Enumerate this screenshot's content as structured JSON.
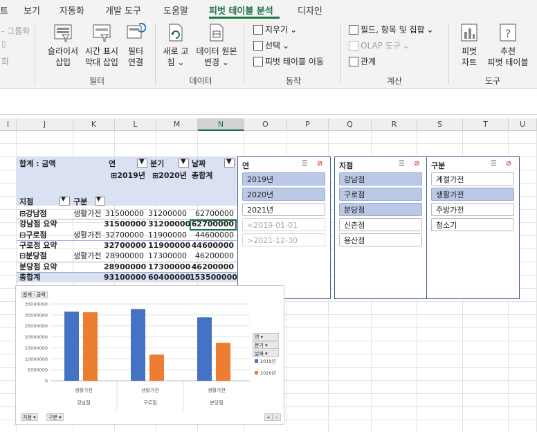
{
  "tabs": {
    "items": [
      "트",
      "보기",
      "자동화",
      "개발 도구",
      "도움말",
      "피벗 테이블 분석",
      "디자인"
    ],
    "active_index": 5
  },
  "ribbon": {
    "group_cut": {
      "label_1": "- 그룹화",
      "label_2": "화"
    },
    "filter": {
      "slicer": [
        "슬라이서",
        "삽입"
      ],
      "timeline": [
        "시간 표시",
        "막대 삽입"
      ],
      "connect": [
        "필터",
        "연결"
      ],
      "group_label": "필터"
    },
    "data": {
      "refresh": [
        "새로 고",
        "침"
      ],
      "change_source": [
        "데이터 원본",
        "변경"
      ],
      "group_label": "데이터"
    },
    "actions": {
      "clear": "지우기",
      "select": "선택",
      "move": "피벗 테이블 이동",
      "group_label": "동작"
    },
    "calc": {
      "fields": "필드, 항목 및 집합",
      "olap": "OLAP 도구",
      "relations": "관계",
      "group_label": "계산"
    },
    "tools": {
      "pivot_chart": [
        "피벗",
        "차트"
      ],
      "recommend": [
        "추천",
        "피벗 테이블"
      ],
      "group_label": "도구"
    }
  },
  "columns": [
    "I",
    "J",
    "K",
    "L",
    "M",
    "N",
    "O",
    "P",
    "Q",
    "R",
    "S",
    "T",
    "U"
  ],
  "selected_column": "N",
  "pivot": {
    "sum_label": "합계 : 금액",
    "year_label": "연",
    "quarter_label": "분기",
    "date_label": "날짜",
    "y2019": "2019년",
    "y2020": "2020년",
    "grand_total_col": "총합계",
    "branch_label": "지점",
    "category_label": "구분",
    "rows": [
      {
        "branch": "강남점",
        "category": "생활가전",
        "v2019": "31500000",
        "v2020": "31200000",
        "total": "62700000"
      },
      {
        "subtotal": "강남점 요약",
        "v2019": "31500000",
        "v2020": "31200000",
        "total": "62700000"
      },
      {
        "branch": "구로점",
        "category": "생활가전",
        "v2019": "32700000",
        "v2020": "11900000",
        "total": "44600000"
      },
      {
        "subtotal": "구로점 요약",
        "v2019": "32700000",
        "v2020": "11900000",
        "total": "44600000"
      },
      {
        "branch": "분당점",
        "category": "생활가전",
        "v2019": "28900000",
        "v2020": "17300000",
        "total": "46200000"
      },
      {
        "subtotal": "분당점 요약",
        "v2019": "28900000",
        "v2020": "17300000",
        "total": "46200000"
      },
      {
        "grand": "총합계",
        "v2019": "93100000",
        "v2020": "60400000",
        "total": "153500000"
      }
    ]
  },
  "slicers": {
    "year": {
      "title": "연",
      "items": [
        {
          "label": "2019년",
          "state": "on"
        },
        {
          "label": "2020년",
          "state": "on"
        },
        {
          "label": "2021년",
          "state": "off"
        },
        {
          "label": "<2019-01-01",
          "state": "dim"
        },
        {
          "label": ">2021-12-30",
          "state": "dim"
        }
      ]
    },
    "branch": {
      "title": "지점",
      "items": [
        {
          "label": "강남점",
          "state": "on"
        },
        {
          "label": "구로점",
          "state": "on"
        },
        {
          "label": "분당점",
          "state": "on"
        },
        {
          "label": "신촌점",
          "state": "off"
        },
        {
          "label": "용산점",
          "state": "off"
        }
      ]
    },
    "category": {
      "title": "구분",
      "items": [
        {
          "label": "계절가전",
          "state": "off"
        },
        {
          "label": "생활가전",
          "state": "on"
        },
        {
          "label": "주방가전",
          "state": "off"
        },
        {
          "label": "청소기",
          "state": "off"
        }
      ]
    }
  },
  "chart_buttons": {
    "sum": "합계 : 금액",
    "year": "연",
    "quarter": "분기",
    "date": "날짜",
    "branch": "지점",
    "category": "구분"
  },
  "colors": {
    "s2019": "#4472c4",
    "s2020": "#ed7d31",
    "accent": "#217346"
  },
  "chart_data": {
    "type": "bar",
    "categories": [
      "생활가전",
      "생활가전",
      "생활가전"
    ],
    "groups": [
      "강남점",
      "구로점",
      "분당점"
    ],
    "series": [
      {
        "name": "2019년",
        "values": [
          31500000,
          32700000,
          28900000
        ]
      },
      {
        "name": "2020년",
        "values": [
          31200000,
          11900000,
          17300000
        ]
      }
    ],
    "ylim": [
      0,
      35000000
    ],
    "yticks": [
      "0",
      "5000000",
      "10000000",
      "15000000",
      "20000000",
      "25000000",
      "30000000",
      "35000000"
    ],
    "legend": "right",
    "grid": true
  }
}
